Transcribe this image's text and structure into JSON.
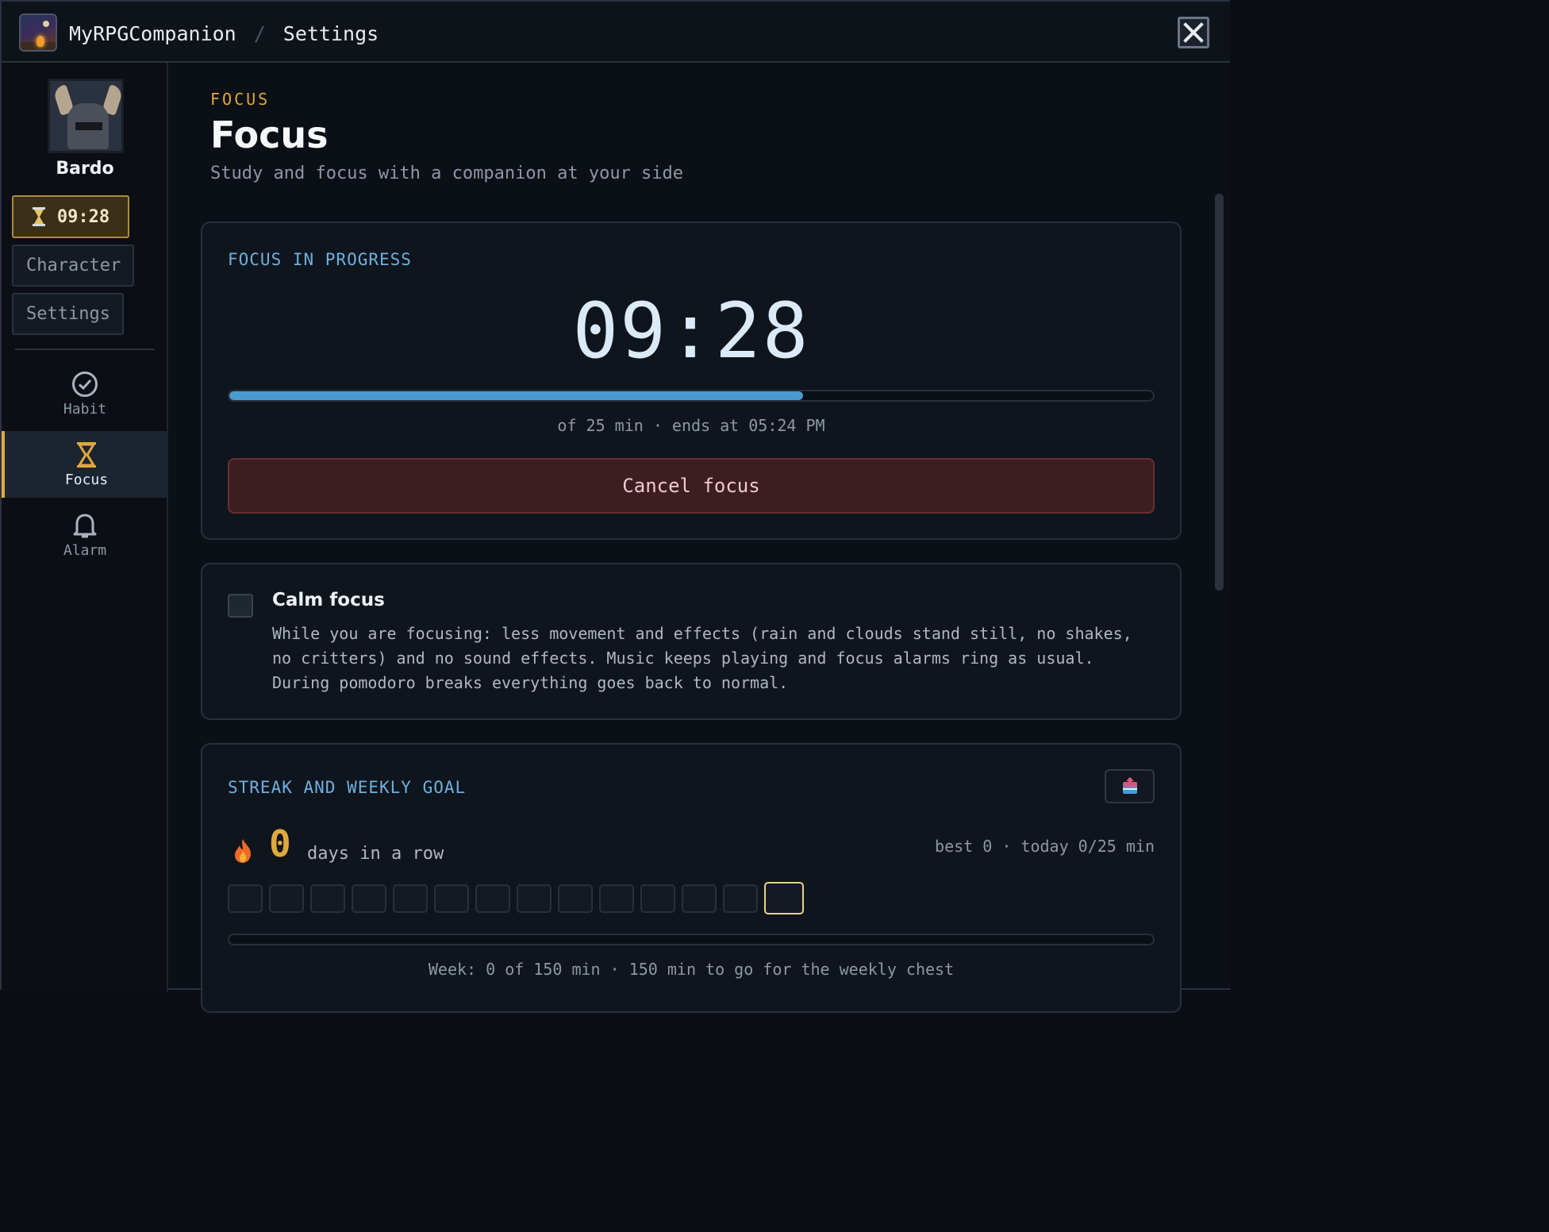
{
  "titlebar": {
    "app_name": "MyRPGCompanion",
    "separator": "/",
    "page": "Settings"
  },
  "sidebar": {
    "character_name": "Bardo",
    "timer": "09:28",
    "buttons": [
      {
        "label": "Character"
      },
      {
        "label": "Settings"
      }
    ],
    "nav": [
      {
        "label": "Habit",
        "icon": "check-circle-icon",
        "active": false
      },
      {
        "label": "Focus",
        "icon": "hourglass-icon",
        "active": true
      },
      {
        "label": "Alarm",
        "icon": "bell-icon",
        "active": false
      }
    ]
  },
  "main": {
    "kicker": "FOCUS",
    "title": "Focus",
    "subtitle": "Study and focus with a companion at your side",
    "progress_card": {
      "heading": "FOCUS IN PROGRESS",
      "time_remaining": "09:28",
      "progress_fraction": 0.621,
      "caption": "of 25 min · ends at 05:24 PM",
      "cancel_label": "Cancel focus"
    },
    "calm_card": {
      "checked": false,
      "title": "Calm focus",
      "description": "While you are focusing: less movement and effects (rain and clouds stand still, no shakes, no critters) and no sound effects. Music keeps playing and focus alarms ring as usual. During pomodoro breaks everything goes back to normal."
    },
    "streak_card": {
      "heading": "STREAK AND WEEKLY GOAL",
      "chest_icon": "chest-icon",
      "streak_count": "0",
      "streak_label": "days in a row",
      "meta": "best 0 · today 0/25 min",
      "days_total": 14,
      "today_index": 13,
      "week_fraction": 0,
      "week_caption": "Week: 0 of 150 min · 150 min to go for the weekly chest"
    }
  },
  "colors": {
    "accent": "#e0a83c",
    "progress": "#4a9ad0",
    "danger_bg": "#3c1e22",
    "kicker_blue": "#6fb0e0"
  }
}
